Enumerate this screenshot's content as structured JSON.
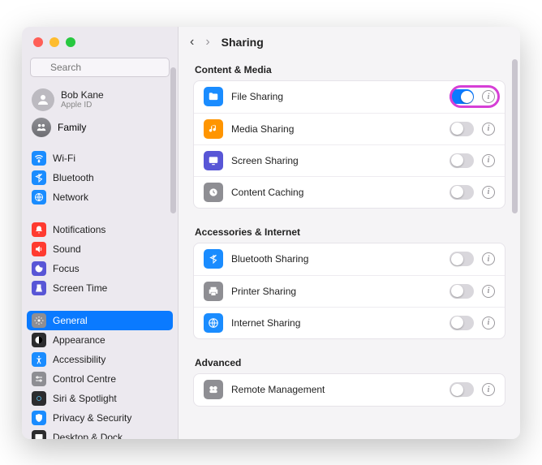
{
  "window": {
    "title": "Sharing"
  },
  "search": {
    "placeholder": "Search"
  },
  "user": {
    "name": "Bob Kane",
    "sub": "Apple ID"
  },
  "family": {
    "label": "Family"
  },
  "sidebar": {
    "group1": [
      {
        "label": "Wi-Fi",
        "icon": "wifi-icon",
        "bg": "ic-blue"
      },
      {
        "label": "Bluetooth",
        "icon": "bluetooth-icon",
        "bg": "ic-blue"
      },
      {
        "label": "Network",
        "icon": "network-icon",
        "bg": "ic-blue"
      }
    ],
    "group2": [
      {
        "label": "Notifications",
        "icon": "bell-icon",
        "bg": "ic-red"
      },
      {
        "label": "Sound",
        "icon": "sound-icon",
        "bg": "ic-red"
      },
      {
        "label": "Focus",
        "icon": "focus-icon",
        "bg": "ic-purple"
      },
      {
        "label": "Screen Time",
        "icon": "screentime-icon",
        "bg": "ic-purple"
      }
    ],
    "group3": [
      {
        "label": "General",
        "icon": "general-icon",
        "bg": "ic-gray",
        "selected": true
      },
      {
        "label": "Appearance",
        "icon": "appearance-icon",
        "bg": "ic-black"
      },
      {
        "label": "Accessibility",
        "icon": "accessibility-icon",
        "bg": "ic-blue"
      },
      {
        "label": "Control Centre",
        "icon": "control-icon",
        "bg": "ic-gray"
      },
      {
        "label": "Siri & Spotlight",
        "icon": "siri-icon",
        "bg": "ic-black"
      },
      {
        "label": "Privacy & Security",
        "icon": "privacy-icon",
        "bg": "ic-blue"
      },
      {
        "label": "Desktop & Dock",
        "icon": "dock-icon",
        "bg": "ic-black"
      }
    ]
  },
  "sections": [
    {
      "title": "Content & Media",
      "rows": [
        {
          "label": "File Sharing",
          "icon": "folder-icon",
          "bg": "ic-blue",
          "on": true,
          "highlight": true
        },
        {
          "label": "Media Sharing",
          "icon": "media-icon",
          "bg": "#ff9500",
          "on": false
        },
        {
          "label": "Screen Sharing",
          "icon": "screen-icon",
          "bg": "#5856d6",
          "on": false
        },
        {
          "label": "Content Caching",
          "icon": "cache-icon",
          "bg": "#8e8e93",
          "on": false
        }
      ]
    },
    {
      "title": "Accessories & Internet",
      "rows": [
        {
          "label": "Bluetooth Sharing",
          "icon": "bluetooth-icon",
          "bg": "#1a8cff",
          "on": false
        },
        {
          "label": "Printer Sharing",
          "icon": "printer-icon",
          "bg": "#8e8e93",
          "on": false
        },
        {
          "label": "Internet Sharing",
          "icon": "globe-icon",
          "bg": "#1a8cff",
          "on": false
        }
      ]
    },
    {
      "title": "Advanced",
      "rows": [
        {
          "label": "Remote Management",
          "icon": "remote-icon",
          "bg": "#8e8e93",
          "on": false
        }
      ]
    }
  ]
}
